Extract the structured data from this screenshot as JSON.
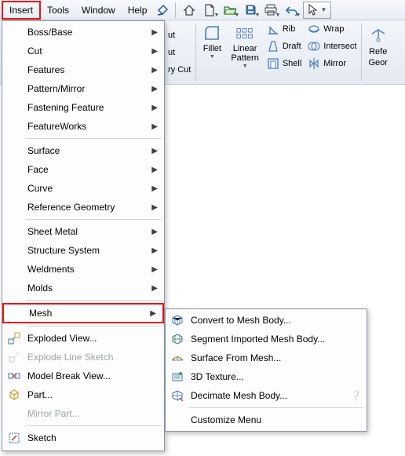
{
  "menubar": {
    "items": [
      "Insert",
      "Tools",
      "Window",
      "Help"
    ],
    "active_index": 0
  },
  "ribbon": {
    "left_partial": [
      "ut",
      "ut",
      "ry Cut"
    ],
    "fillet": "Fillet",
    "linear_pattern": "Linear\nPattern",
    "col_rib": "Rib",
    "col_draft": "Draft",
    "col_shell": "Shell",
    "col_wrap": "Wrap",
    "col_intersect": "Intersect",
    "col_mirror": "Mirror",
    "ref_partial_top": "Refe",
    "ref_partial_bot": "Geor"
  },
  "insert_menu": [
    {
      "label": "Boss/Base",
      "arrow": true
    },
    {
      "label": "Cut",
      "arrow": true
    },
    {
      "label": "Features",
      "arrow": true
    },
    {
      "label": "Pattern/Mirror",
      "arrow": true
    },
    {
      "label": "Fastening Feature",
      "arrow": true
    },
    {
      "label": "FeatureWorks",
      "arrow": true
    },
    {
      "divider": true
    },
    {
      "label": "Surface",
      "arrow": true
    },
    {
      "label": "Face",
      "arrow": true
    },
    {
      "label": "Curve",
      "arrow": true
    },
    {
      "label": "Reference Geometry",
      "arrow": true
    },
    {
      "divider": true
    },
    {
      "label": "Sheet Metal",
      "arrow": true
    },
    {
      "label": "Structure System",
      "arrow": true
    },
    {
      "label": "Weldments",
      "arrow": true
    },
    {
      "label": "Molds",
      "arrow": true
    },
    {
      "divider": true
    },
    {
      "label": "Mesh",
      "arrow": true,
      "highlight": true
    },
    {
      "divider": true
    },
    {
      "label": "Exploded View...",
      "icon": "exploded"
    },
    {
      "label": "Explode Line Sketch",
      "icon": "expline",
      "disabled": true
    },
    {
      "label": "Model Break View...",
      "icon": "break"
    },
    {
      "label": "Part...",
      "icon": "part"
    },
    {
      "label": "Mirror Part...",
      "disabled": true
    },
    {
      "divider": true
    },
    {
      "label": "Sketch",
      "icon": "sketch"
    }
  ],
  "mesh_submenu": [
    {
      "label": "Convert to Mesh Body...",
      "icon": "convert"
    },
    {
      "label": "Segment Imported Mesh Body...",
      "icon": "segment"
    },
    {
      "label": "Surface From Mesh...",
      "icon": "surfmesh"
    },
    {
      "label": "3D Texture...",
      "icon": "tex3d"
    },
    {
      "label": "Decimate Mesh Body...",
      "icon": "decimate",
      "help": true
    },
    {
      "divider": true
    },
    {
      "label": "Customize Menu"
    }
  ]
}
